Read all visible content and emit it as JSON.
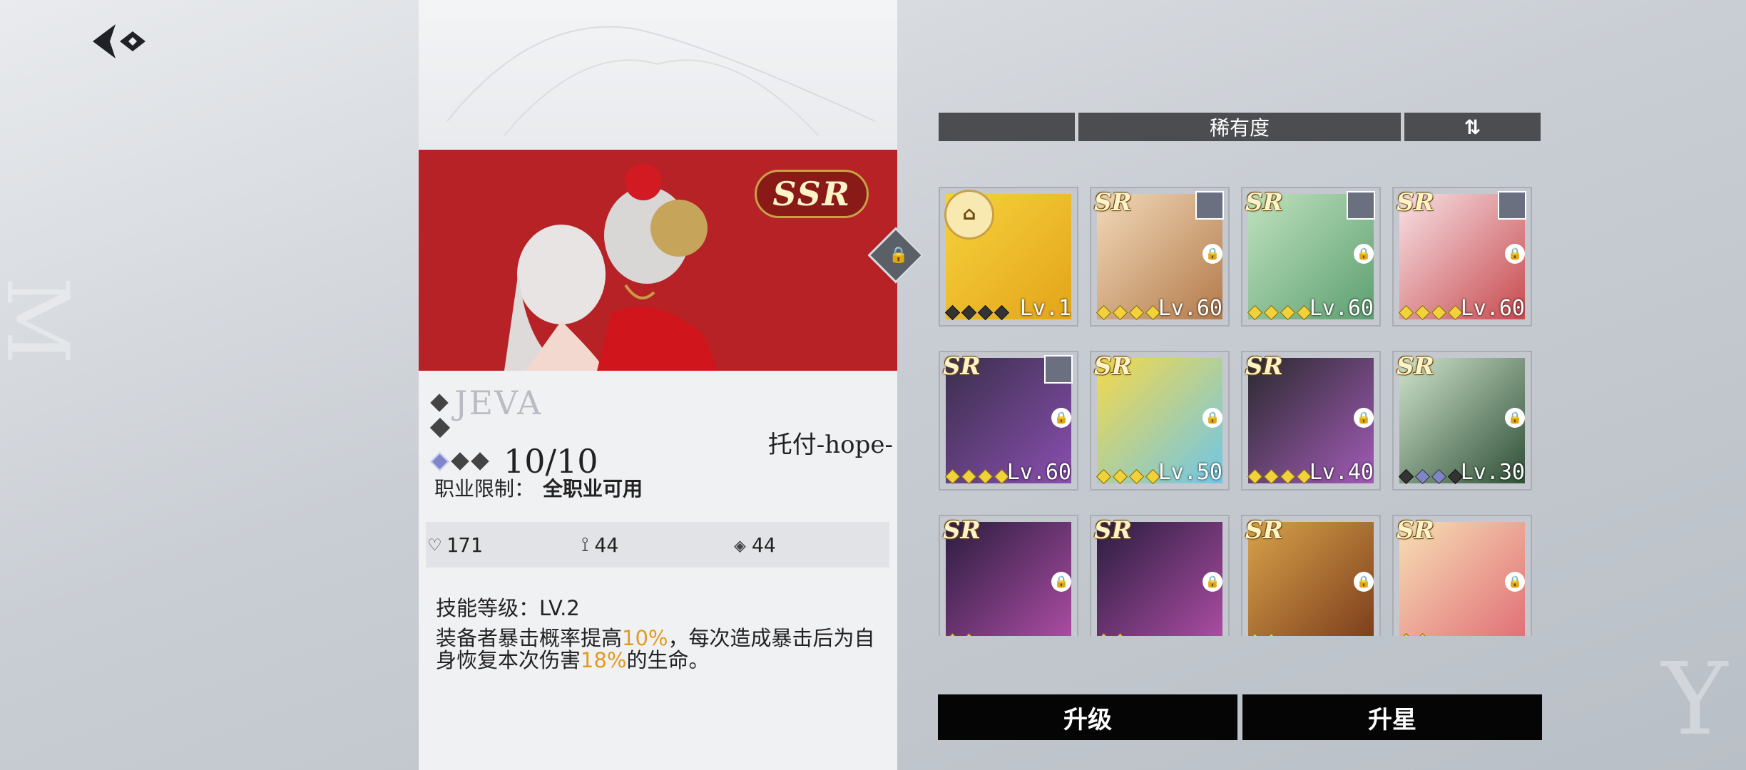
{
  "weapon": {
    "name": "JEVA",
    "rarity_badge": "SSR",
    "level": "10/10",
    "owner": "托付-hope-",
    "job_label": "职业限制：",
    "job_value": "全职业可用",
    "stats": [
      {
        "icon": "heart-icon",
        "value": "171"
      },
      {
        "icon": "sword-icon",
        "value": "44"
      },
      {
        "icon": "shield-icon",
        "value": "44"
      }
    ],
    "skill_level": "技能等级：LV.2",
    "skill_desc_parts": [
      "装备者暴击概率提高",
      "10%",
      "，每次造成暴击后为自身恢复本次伤害",
      "18%",
      "的生命。"
    ]
  },
  "filter": {
    "left_label": "",
    "sort_label": "稀有度",
    "order_icon": "sort-order-icon"
  },
  "cards": [
    {
      "rarity": "",
      "level": "Lv.1",
      "equipped": true,
      "locked": false,
      "colors": [
        "#f6d23c",
        "#e3a41a"
      ],
      "avatar": false
    },
    {
      "rarity": "SR",
      "level": "Lv.60",
      "equipped": false,
      "locked": true,
      "colors": [
        "#f2d9b9",
        "#b37a4a"
      ],
      "avatar": true
    },
    {
      "rarity": "SR",
      "level": "Lv.60",
      "equipped": false,
      "locked": true,
      "colors": [
        "#bfe2bd",
        "#5d9f71"
      ],
      "avatar": true
    },
    {
      "rarity": "SR",
      "level": "Lv.60",
      "equipped": false,
      "locked": true,
      "colors": [
        "#f7e2e6",
        "#c74a4e"
      ],
      "avatar": true
    },
    {
      "rarity": "SR",
      "level": "Lv.60",
      "equipped": false,
      "locked": true,
      "colors": [
        "#3a2f4c",
        "#8a4fb0"
      ],
      "avatar": true
    },
    {
      "rarity": "SR",
      "level": "Lv.50",
      "equipped": false,
      "locked": true,
      "colors": [
        "#f5d94a",
        "#6fc6e8"
      ],
      "avatar": false
    },
    {
      "rarity": "SR",
      "level": "Lv.40",
      "equipped": false,
      "locked": true,
      "colors": [
        "#2a2a2e",
        "#a35bb8"
      ],
      "avatar": false
    },
    {
      "rarity": "SR",
      "level": "Lv.30",
      "equipped": false,
      "locked": true,
      "colors": [
        "#cfe3cc",
        "#2f4f36"
      ],
      "avatar": false
    },
    {
      "rarity": "SR",
      "level": "",
      "equipped": false,
      "locked": true,
      "colors": [
        "#2a1d3f",
        "#b04ea6"
      ],
      "avatar": false
    },
    {
      "rarity": "SR",
      "level": "",
      "equipped": false,
      "locked": true,
      "colors": [
        "#2a1d3f",
        "#b04ea6"
      ],
      "avatar": false
    },
    {
      "rarity": "SR",
      "level": "",
      "equipped": false,
      "locked": true,
      "colors": [
        "#d8a24a",
        "#7a3a1a"
      ],
      "avatar": false
    },
    {
      "rarity": "SR",
      "level": "",
      "equipped": false,
      "locked": true,
      "colors": [
        "#f7e0b6",
        "#e06b74"
      ],
      "avatar": false
    }
  ],
  "buttons": {
    "upgrade": "升级",
    "star_up": "升星"
  },
  "colors": {
    "accent_red": "#b62226",
    "highlight": "#e39a1e",
    "button_bg": "#050505"
  }
}
